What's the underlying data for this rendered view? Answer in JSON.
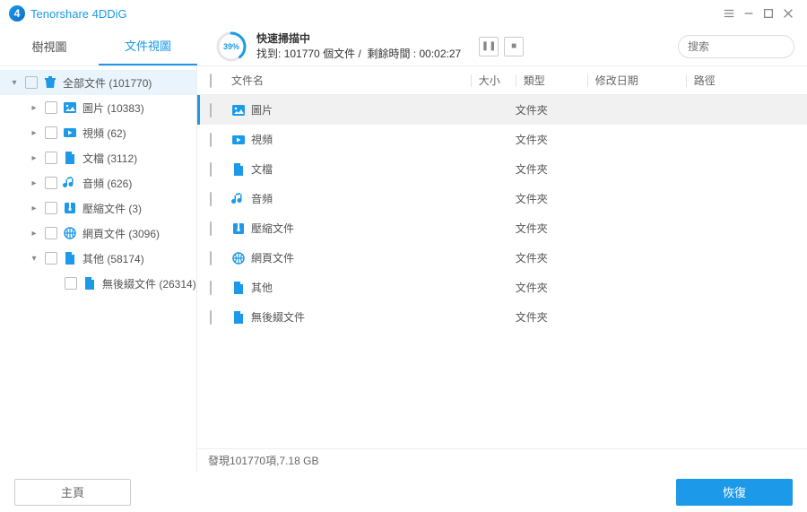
{
  "app": {
    "title": "Tenorshare 4DDiG"
  },
  "tabs": {
    "tree": "樹視圖",
    "file": "文件視圖"
  },
  "scan": {
    "percent": 39,
    "title": "快速掃描中",
    "status_prefix": "找到:",
    "found_count": "101770",
    "files_word": "個文件",
    "sep": "/",
    "remain_label": "剩餘時間 :",
    "remain_time": "00:02:27"
  },
  "search": {
    "placeholder": "搜索"
  },
  "sidebar": {
    "items": [
      {
        "label": "全部文件 (101770)",
        "icon": "trash",
        "depth": 0,
        "expanded": true,
        "arrow": "down",
        "selected": true
      },
      {
        "label": "圖片 (10383)",
        "icon": "image",
        "depth": 1,
        "arrow": "right"
      },
      {
        "label": "視頻 (62)",
        "icon": "video",
        "depth": 1,
        "arrow": "right"
      },
      {
        "label": "文檔 (3112)",
        "icon": "doc",
        "depth": 1,
        "arrow": "right"
      },
      {
        "label": "音頻 (626)",
        "icon": "audio",
        "depth": 1,
        "arrow": "right"
      },
      {
        "label": "壓縮文件 (3)",
        "icon": "archive",
        "depth": 1,
        "arrow": "right"
      },
      {
        "label": "網頁文件 (3096)",
        "icon": "web",
        "depth": 1,
        "arrow": "right"
      },
      {
        "label": "其他 (58174)",
        "icon": "doc",
        "depth": 1,
        "arrow": "down"
      },
      {
        "label": "無後綴文件 (26314)",
        "icon": "doc",
        "depth": 2,
        "arrow": "none"
      }
    ]
  },
  "columns": {
    "name": "文件名",
    "size": "大小",
    "type": "類型",
    "date": "修改日期",
    "path": "路徑"
  },
  "rows": [
    {
      "name": "圖片",
      "icon": "image",
      "type": "文件夾",
      "selected": true
    },
    {
      "name": "視頻",
      "icon": "video",
      "type": "文件夾"
    },
    {
      "name": "文檔",
      "icon": "doc",
      "type": "文件夾"
    },
    {
      "name": "音頻",
      "icon": "audio",
      "type": "文件夾"
    },
    {
      "name": "壓縮文件",
      "icon": "archive",
      "type": "文件夾"
    },
    {
      "name": "網頁文件",
      "icon": "web",
      "type": "文件夾"
    },
    {
      "name": "其他",
      "icon": "doc",
      "type": "文件夾"
    },
    {
      "name": "無後綴文件",
      "icon": "doc",
      "type": "文件夾"
    }
  ],
  "status": {
    "found_prefix": "發現",
    "count": "101770",
    "items_word": "項",
    "sep": " , ",
    "size": "7.18 GB"
  },
  "footer": {
    "home": "主頁",
    "recover": "恢復"
  },
  "icons": {
    "trash": "#1c99e8",
    "image": "#1c99e8",
    "video": "#1c99e8",
    "doc": "#1c99e8",
    "audio": "#1c99e8",
    "archive": "#1c99e8",
    "web": "#1c99e8"
  }
}
